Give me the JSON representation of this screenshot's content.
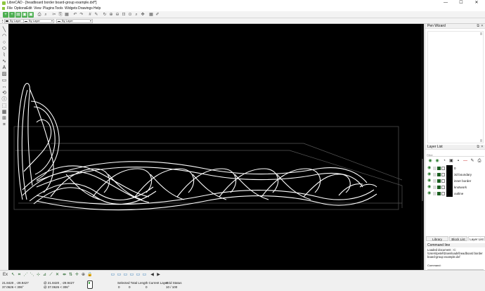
{
  "window": {
    "title": "LibreCAD - [headboard border board-group example.dxf*]",
    "controls": [
      "—",
      "☐",
      "✕"
    ]
  },
  "menubar": {
    "items": [
      "File",
      "Options",
      "Edit",
      "View",
      "Plugins",
      "Tools",
      "Widgets",
      "Drawings",
      "Help"
    ]
  },
  "penbar": {
    "color": "By Layer",
    "width": "By Layer",
    "linetype": "By Layer"
  },
  "pen_wizard": {
    "title": "Pen Wizard"
  },
  "layer_list": {
    "title": "Layer List",
    "filter_placeholder": "Filter",
    "layers": [
      {
        "name": "0",
        "visible": true
      },
      {
        "name": "3d boundary",
        "visible": true
      },
      {
        "name": "inner border",
        "visible": true
      },
      {
        "name": "knotwork",
        "visible": true
      },
      {
        "name": "outline",
        "visible": true
      }
    ]
  },
  "dock_tabs": [
    "Library Browser",
    "Block List",
    "Layer List"
  ],
  "command_line": {
    "title": "Command line",
    "output": [
      "Loaded document : C:",
      "\\Users\\petel\\Downloads\\headboard border",
      "board-group example.dxf"
    ],
    "input_label": "Command:"
  },
  "status": {
    "coords_abs_1": "21.8420 , -29.9427",
    "coords_abs_2": "37.0626 < 306°",
    "coords_rel_1": "@  21.8420 , -29.9427",
    "coords_rel_2": "@  37.0626 < 306°",
    "selection_header": "Selected Total Length  Current Layer",
    "selection_values": [
      "0",
      "0",
      "0"
    ],
    "grid_header": "Grid Status",
    "grid_value": "10 / 100"
  },
  "icons": {
    "left_tools": [
      "line-icon",
      "arc-icon",
      "circle-icon",
      "ellipse-icon",
      "polyline-icon",
      "spline-icon",
      "text-icon",
      "hatch-icon",
      "image-icon",
      "dimension-icon",
      "modify-icon",
      "info-icon",
      "select-icon",
      "block-icon",
      "insert-icon",
      "snap-icon"
    ]
  },
  "colors": {
    "canvas": "#000000",
    "accent_green": "#4caf50",
    "drawing_line": "#ffffff",
    "boundary_gray": "#555555"
  }
}
